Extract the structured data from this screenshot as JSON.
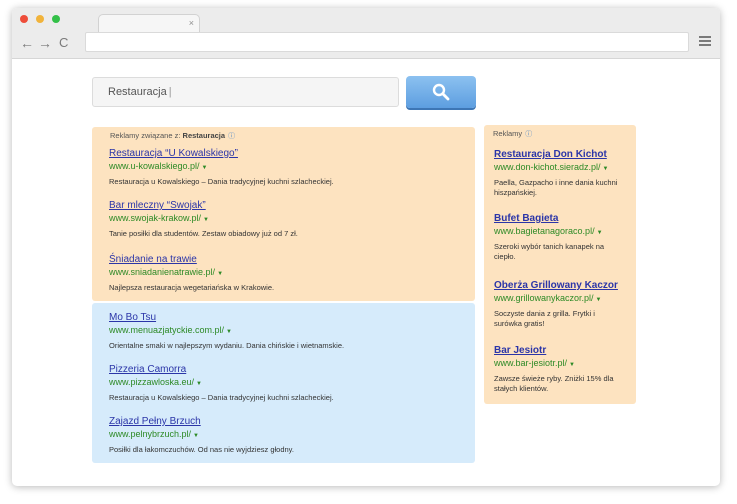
{
  "browser": {
    "tab_close": "×",
    "back_icon": "←",
    "forward_icon": "→",
    "reload_icon": "C"
  },
  "search": {
    "query": "Restauracja"
  },
  "top_ads": {
    "label_prefix": "Reklamy związane z: ",
    "label_query": "Restauracja",
    "info_icon": "ⓘ",
    "items": [
      {
        "title": "Restauracja “U Kowalskiego”",
        "url": "www.u-kowalskiego.pl/",
        "desc": "Restauracja u Kowalskiego – Dania tradycyjnej kuchni szlacheckiej."
      },
      {
        "title": "Bar mleczny “Swojak”",
        "url": "www.swojak-krakow.pl/",
        "desc": "Tanie posiłki dla studentów. Zestaw obiadowy już od 7 zł."
      },
      {
        "title": "Śniadanie na trawie",
        "url": "www.sniadanienatrawie.pl/",
        "desc": "Najlepsza restauracja wegetariańska w Krakowie."
      }
    ]
  },
  "bottom_results": {
    "items": [
      {
        "title": "Mo Bo Tsu",
        "url": "www.menuazjatyckie.com.pl/",
        "desc": "Orientalne smaki w najlepszym wydaniu. Dania chińskie i wietnamskie."
      },
      {
        "title": "Pizzeria Camorra",
        "url": "www.pizzawloska.eu/",
        "desc": "Restauracja u Kowalskiego – Dania tradycyjnej kuchni szlacheckiej."
      },
      {
        "title": "Zajazd Pełny Brzuch",
        "url": "www.pelnybrzuch.pl/",
        "desc": "Posiłki dla łakomczuchów. Od nas nie wyjdziesz głodny."
      }
    ]
  },
  "side_ads": {
    "label": "Reklamy",
    "info_icon": "ⓘ",
    "items": [
      {
        "title": "Restauracja Don Kichot",
        "url": "www.don-kichot.sieradz.pl/",
        "desc": "Paella, Gazpacho i inne dania kuchni hiszpańskiej."
      },
      {
        "title": "Bufet Bagieta",
        "url": "www.bagietanagoraco.pl/",
        "desc": "Szeroki wybór tanich kanapek na ciepło."
      },
      {
        "title": "Oberża Grillowany Kaczor",
        "url": "www.grillowanykaczor.pl/",
        "desc": "Soczyste dania z grilla. Frytki i surówka gratis!"
      },
      {
        "title": "Bar Jesiotr",
        "url": "www.bar-jesiotr.pl/",
        "desc": "Zawsze świeże ryby. Zniżki 15% dla stałych klientów."
      }
    ]
  },
  "dropdown_arrow": "▼",
  "colors": {
    "ad_panel": "#fde3c0",
    "result_panel": "#d6ebfb",
    "link": "#2b35a8",
    "url": "#2d8a26",
    "search_button": "#6aa8e6"
  }
}
